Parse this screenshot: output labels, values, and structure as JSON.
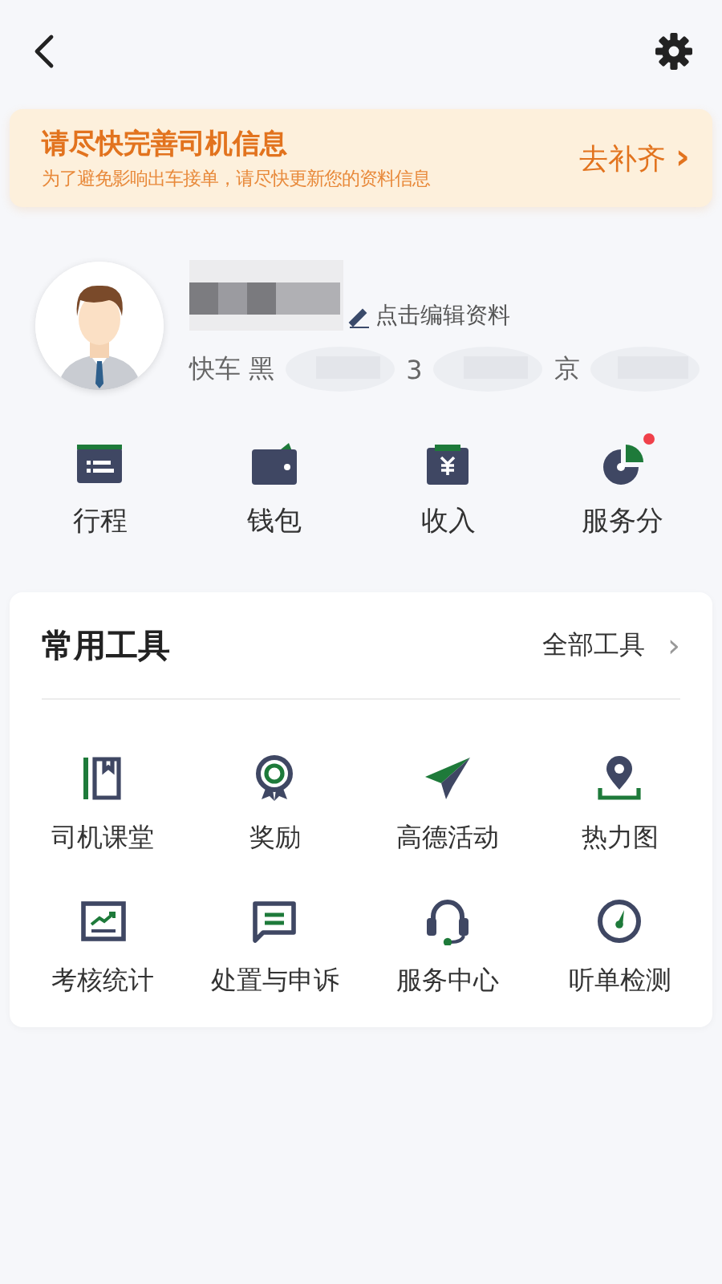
{
  "banner": {
    "title": "请尽快完善司机信息",
    "subtitle": "为了避免影响出车接单，请尽快更新您的资料信息",
    "action": "去补齐",
    "action_arrow": "›"
  },
  "profile": {
    "edit_link": "点击编辑资料",
    "vehicle_parts": [
      "快车 黑",
      "3",
      "京"
    ]
  },
  "shortcuts": [
    {
      "label": "行程",
      "badge": false
    },
    {
      "label": "钱包",
      "badge": false
    },
    {
      "label": "收入",
      "badge": false
    },
    {
      "label": "服务分",
      "badge": true
    }
  ],
  "tools": {
    "title": "常用工具",
    "all_link": "全部工具",
    "all_arrow": "›",
    "items": [
      {
        "label": "司机课堂"
      },
      {
        "label": "奖励"
      },
      {
        "label": "高德活动"
      },
      {
        "label": "热力图"
      },
      {
        "label": "考核统计"
      },
      {
        "label": "处置与申诉"
      },
      {
        "label": "服务中心"
      },
      {
        "label": "听单检测"
      }
    ]
  }
}
